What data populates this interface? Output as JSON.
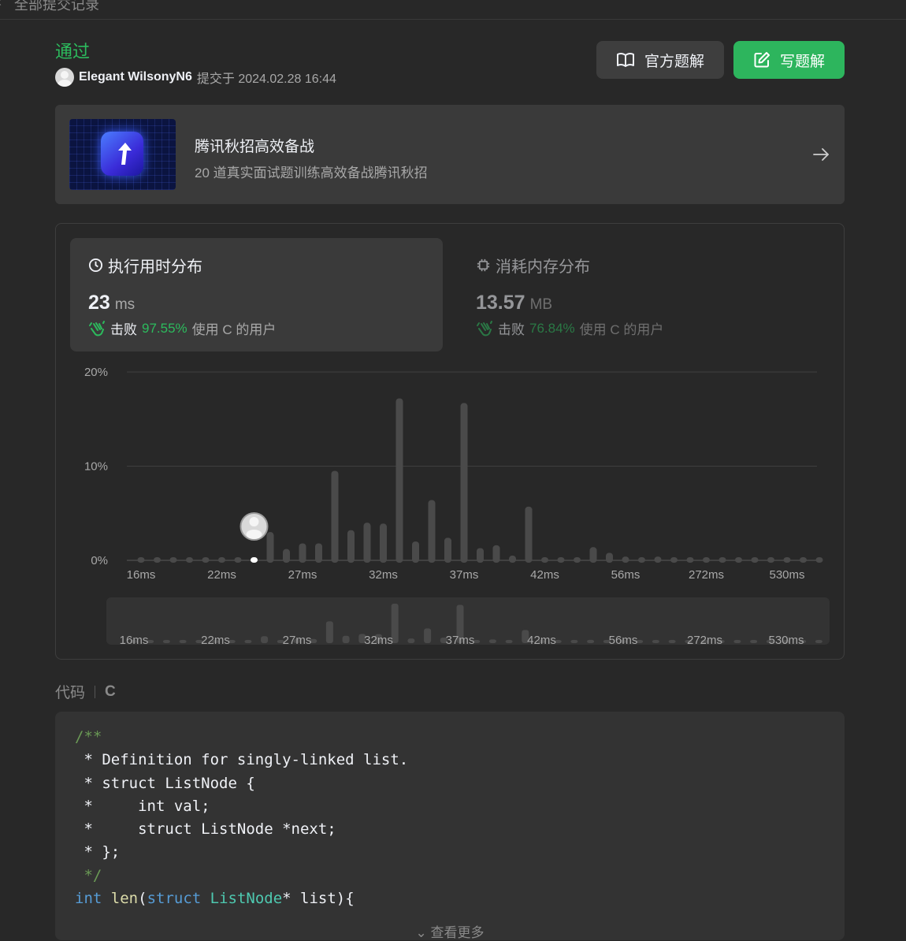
{
  "topbar": {
    "back_icon": "chevron-left-icon",
    "title": "全部提交记录"
  },
  "submission": {
    "status": "通过",
    "username": "Elegant WilsonyN6",
    "submitted_text": "提交于 2024.02.28 16:44"
  },
  "buttons": {
    "official": "官方题解",
    "write": "写题解"
  },
  "promo": {
    "title": "腾讯秋招高效备战",
    "subtitle": "20 道真实面试题训练高效备战腾讯秋招"
  },
  "runtime": {
    "title": "执行用时分布",
    "value": "23",
    "unit": "ms",
    "beat_prefix": "击败",
    "beat_pct": "97.55%",
    "beat_suffix": "使用 C 的用户"
  },
  "memory": {
    "title": "消耗内存分布",
    "value": "13.57",
    "unit": "MB",
    "beat_prefix": "击败",
    "beat_pct": "76.84%",
    "beat_suffix": "使用 C 的用户"
  },
  "colors": {
    "accent_green": "#2cbb5d",
    "bar": "#4a4a4a",
    "bar_current": "#ffffff"
  },
  "chart_data": {
    "type": "bar",
    "title": "",
    "xlabel": "",
    "ylabel": "",
    "ylim": [
      0,
      20
    ],
    "yticks": [
      "0%",
      "10%",
      "20%"
    ],
    "xticks": [
      "16ms",
      "22ms",
      "27ms",
      "32ms",
      "37ms",
      "42ms",
      "56ms",
      "272ms",
      "530ms"
    ],
    "current_index": 7,
    "values": [
      0.3,
      0.3,
      0.3,
      0.3,
      0.3,
      0.3,
      0.3,
      0.3,
      3.0,
      1.2,
      1.8,
      1.8,
      9.5,
      3.2,
      4.0,
      3.9,
      17.2,
      2.0,
      6.4,
      2.4,
      16.7,
      1.3,
      1.6,
      0.5,
      5.7,
      0.3,
      0.3,
      0.3,
      1.4,
      0.8,
      0.4,
      0.3,
      0.4,
      0.3,
      0.3,
      0.3,
      0.3,
      0.3,
      0.3,
      0.3,
      0.3,
      0.3,
      0.3
    ],
    "grid": true
  },
  "code": {
    "label": "代码",
    "language": "C",
    "more": "查看更多",
    "lines": [
      [
        {
          "t": "/**",
          "c": "c"
        }
      ],
      [
        {
          "t": " * Definition for singly-linked list.",
          "c": ""
        }
      ],
      [
        {
          "t": " * struct ListNode {",
          "c": ""
        }
      ],
      [
        {
          "t": " *     int val;",
          "c": ""
        }
      ],
      [
        {
          "t": " *     struct ListNode *next;",
          "c": ""
        }
      ],
      [
        {
          "t": " * };",
          "c": ""
        }
      ],
      [
        {
          "t": " */",
          "c": "c"
        }
      ],
      [
        {
          "t": "int",
          "c": "kw"
        },
        {
          "t": " ",
          "c": ""
        },
        {
          "t": "len",
          "c": "fn"
        },
        {
          "t": "(",
          "c": ""
        },
        {
          "t": "struct",
          "c": "kw"
        },
        {
          "t": " ",
          "c": ""
        },
        {
          "t": "ListNode",
          "c": "ty"
        },
        {
          "t": "* list){",
          "c": ""
        }
      ]
    ]
  }
}
